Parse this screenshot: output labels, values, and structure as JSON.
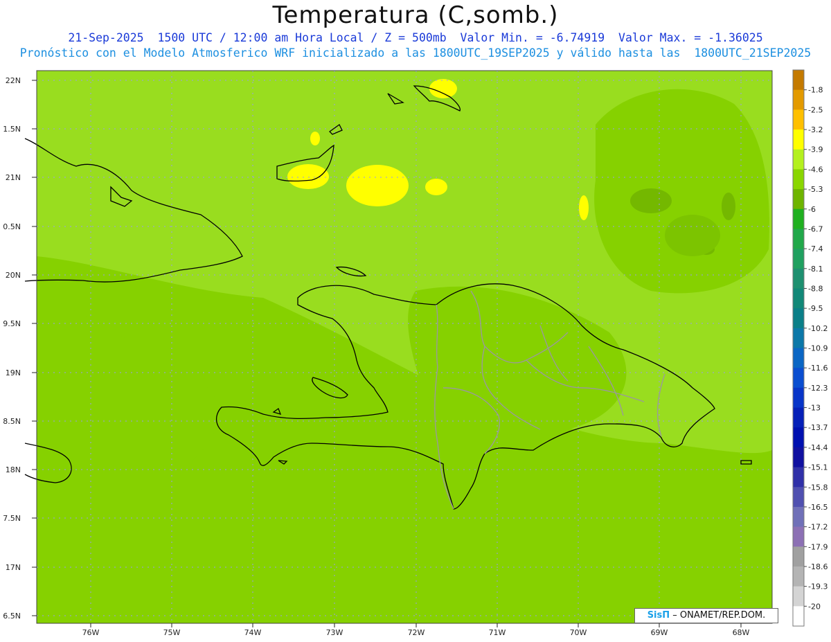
{
  "header": {
    "title": "Temperatura (C,somb.)",
    "line1": "21-Sep-2025  1500 UTC / 12:00 am Hora Local / Z = 500mb  Valor Min. = -6.74919  Valor Max. = -1.36025",
    "line2": "Pronóstico con el Modelo Atmosferico WRF inicializado a las 1800UTC_19SEP2025 y válido hasta las  1800UTC_21SEP2025"
  },
  "map": {
    "lat_labels": [
      "22N",
      "1.5N",
      "21N",
      "0.5N",
      "20N",
      "9.5N",
      "19N",
      "8.5N",
      "18N",
      "7.5N",
      "17N",
      "6.5N"
    ],
    "lon_labels": [
      "76W",
      "75W",
      "74W",
      "73W",
      "72W",
      "71W",
      "70W",
      "69W",
      "68W"
    ],
    "colors": {
      "base": "#99dd1f",
      "darker": "#86d100",
      "dark_patch": "#74b800",
      "warm": "#ffff00",
      "gridline": "#9a9aee",
      "coast": "#000000",
      "provinces": "#9a9a9a"
    }
  },
  "colorbar": {
    "levels": [
      "-1.8",
      "-2.5",
      "-3.2",
      "-3.9",
      "-4.6",
      "-5.3",
      "-6",
      "-6.7",
      "-7.4",
      "-8.1",
      "-8.8",
      "-9.5",
      "-10.2",
      "-10.9",
      "-11.6",
      "-12.3",
      "-13",
      "-13.7",
      "-14.4",
      "-15.1",
      "-15.8",
      "-16.5",
      "-17.2",
      "-17.9",
      "-18.6",
      "-19.3",
      "-20"
    ],
    "colors": [
      "#c47a00",
      "#e39a00",
      "#ffc000",
      "#ffff00",
      "#b4f01e",
      "#8ad600",
      "#6eb400",
      "#20b020",
      "#21a84a",
      "#20a060",
      "#1e9070",
      "#128878",
      "#0b7f88",
      "#0c78a8",
      "#0a66c4",
      "#0a4ed0",
      "#0835c8",
      "#0620b8",
      "#0010b0",
      "#1010a0",
      "#3030a8",
      "#5050b0",
      "#7070b8",
      "#8c70b4",
      "#a0a0a0",
      "#b4b4b4",
      "#d4d4d4",
      "#ffffff"
    ]
  },
  "credit": {
    "logo": "SisΠ",
    "org": "– ONAMET/REP.DOM."
  }
}
